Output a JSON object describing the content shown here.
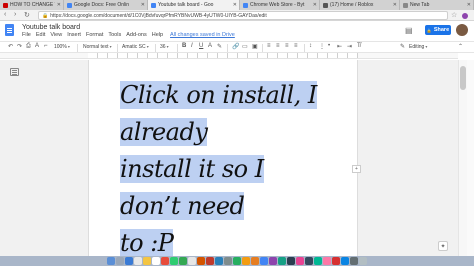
{
  "browser": {
    "tabs": [
      {
        "label": "HOW TO CHANGE YOUR",
        "color": "#cc0000",
        "active": false
      },
      {
        "label": "Google Docs: Free Onlin",
        "color": "#4285f4",
        "active": false
      },
      {
        "label": "Youtube talk board - Goo",
        "color": "#4285f4",
        "active": true
      },
      {
        "label": "Chrome Web Store - Byt",
        "color": "#4285f4",
        "active": false
      },
      {
        "label": "(17) Home / Roblox",
        "color": "#555555",
        "active": false
      },
      {
        "label": "New Tab",
        "color": "#888888",
        "active": false
      }
    ],
    "url": "https://docs.google.com/document/d/1C0VjBdvfuvqrPfmRYBNvUWB-4yUTW0-UIYB-GAYDas/edit"
  },
  "docs": {
    "title": "Youtube talk board",
    "menu": [
      "File",
      "Edit",
      "View",
      "Insert",
      "Format",
      "Tools",
      "Add-ons",
      "Help"
    ],
    "saved_status": "All changes saved in Drive",
    "share_label": "Share",
    "colors": {
      "accent": "#1a73e8",
      "highlight": "#bdd0f2"
    }
  },
  "toolbar": {
    "zoom": "100%",
    "style": "Normal text",
    "font": "Amatic SC",
    "size": "36",
    "editing": "Editing"
  },
  "document": {
    "lines": [
      "Click on install, I already",
      "install it so I don’t need",
      "to :P"
    ]
  }
}
